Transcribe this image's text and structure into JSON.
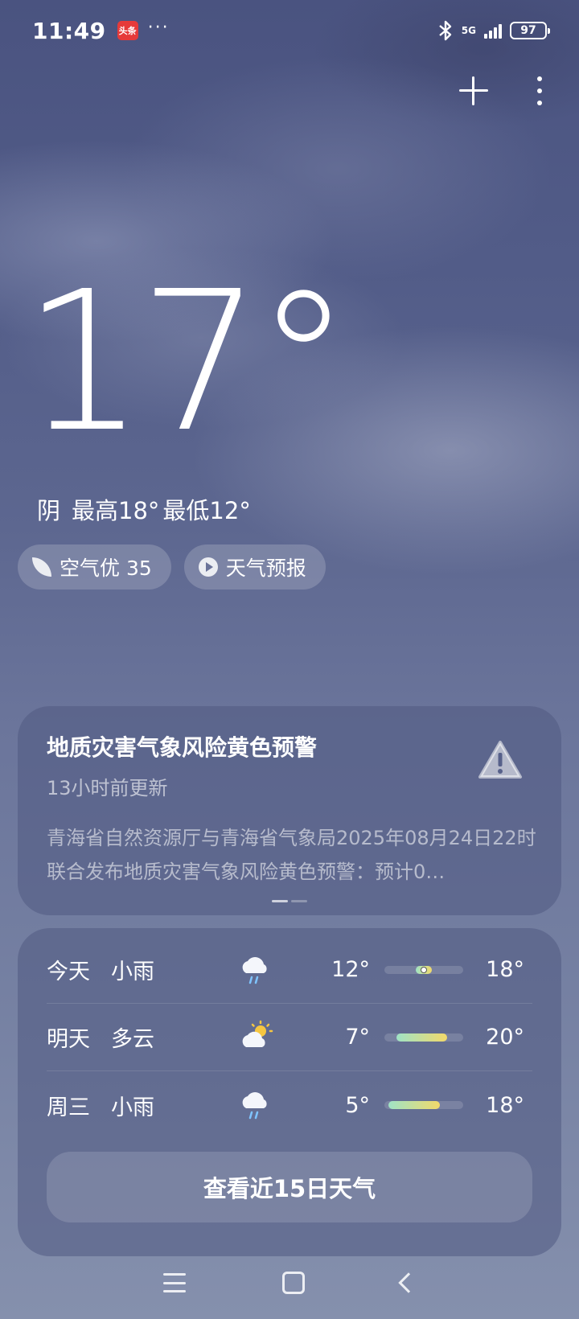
{
  "status_bar": {
    "time": "11:49",
    "app_badge": "头条",
    "more": "···",
    "network": "5G",
    "battery": "97"
  },
  "current": {
    "temperature": "17°",
    "condition": "阴",
    "high": "最高18°",
    "low": "最低12°",
    "air_quality": "空气优 35",
    "forecast_video": "天气预报"
  },
  "alert": {
    "title": "地质灾害气象风险黄色预警",
    "updated": "13小时前更新",
    "body": "青海省自然资源厅与青海省气象局2025年08月24日22时联合发布地质灾害气象风险黄色预警：预计0…"
  },
  "forecast": [
    {
      "day": "今天",
      "condition": "小雨",
      "icon": "light-rain-icon",
      "low": "12°",
      "high": "18°",
      "range": [
        0.4,
        0.6
      ],
      "now": 0.5
    },
    {
      "day": "明天",
      "condition": "多云",
      "icon": "partly-cloudy-icon",
      "low": "7°",
      "high": "20°",
      "range": [
        0.15,
        0.8
      ]
    },
    {
      "day": "周三",
      "condition": "小雨",
      "icon": "light-rain-icon",
      "low": "5°",
      "high": "18°",
      "range": [
        0.05,
        0.7
      ]
    }
  ],
  "view_15_days": "查看近15日天气",
  "colors": {
    "bar_cool": "#9fe3c6",
    "bar_warm": "#f2d96a"
  }
}
